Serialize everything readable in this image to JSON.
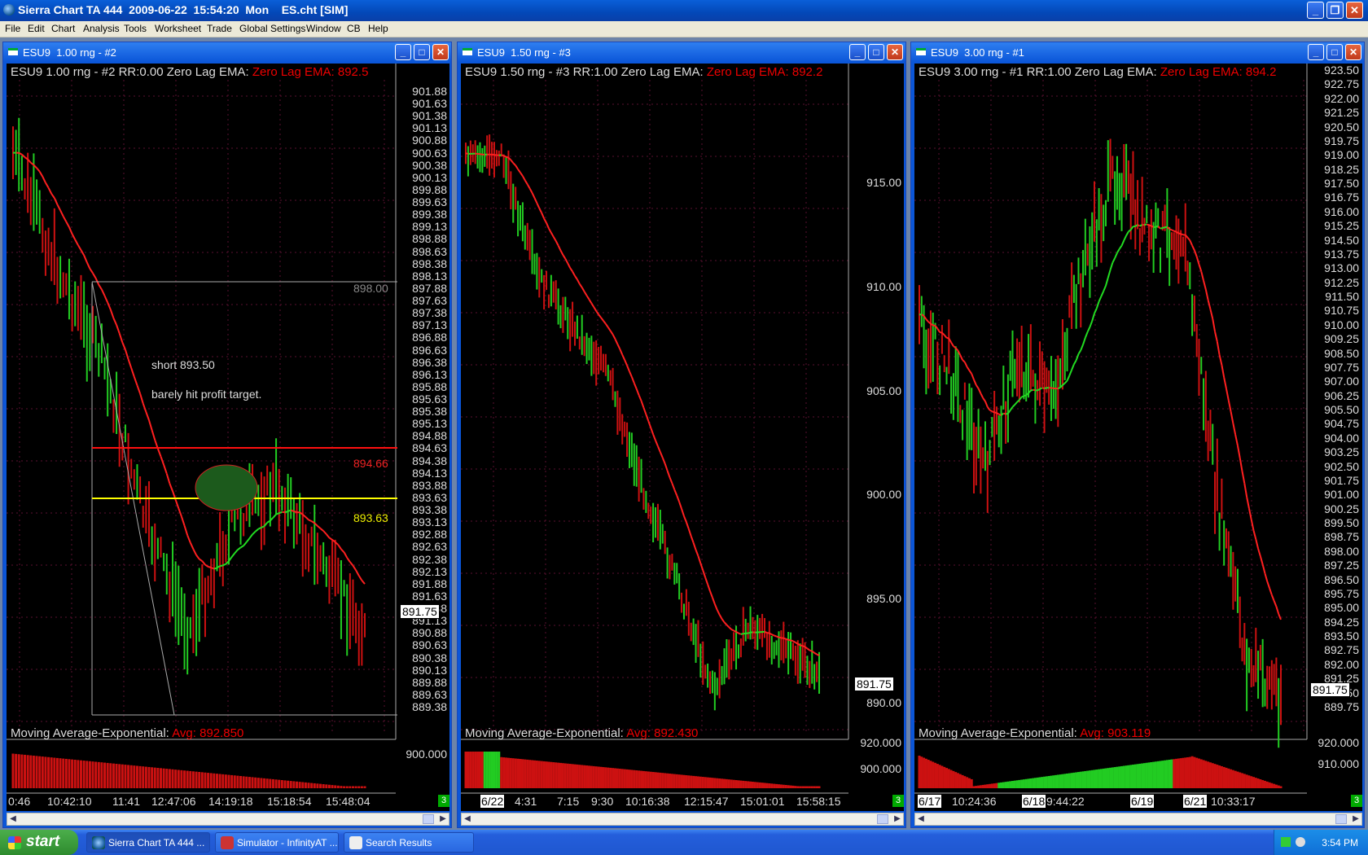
{
  "app": {
    "title": "Sierra Chart TA 444  2009-06-22  15:54:20  Mon    ES.cht [SIM]",
    "menu": [
      "File",
      "Edit",
      "Chart",
      "Analysis",
      "Tools",
      "Worksheet",
      "Trade",
      "Global Settings",
      "Window",
      "CB",
      "Help"
    ]
  },
  "windows": [
    {
      "title": "ESU9  1.00 rng - #2",
      "header": "ESU9  1.00 rng - #2  RR:0.00  Zero Lag EMA:",
      "header_value": "Zero Lag EMA: 892.5",
      "price_labels": [
        "901.88",
        "901.63",
        "901.38",
        "901.13",
        "900.88",
        "900.63",
        "900.38",
        "900.13",
        "899.88",
        "899.63",
        "899.38",
        "899.13",
        "898.88",
        "898.63",
        "898.38",
        "898.13",
        "897.88",
        "897.63",
        "897.38",
        "897.13",
        "896.88",
        "896.63",
        "896.38",
        "896.13",
        "895.88",
        "895.63",
        "895.38",
        "895.13",
        "894.88",
        "894.63",
        "894.38",
        "894.13",
        "893.88",
        "893.63",
        "893.38",
        "893.13",
        "892.88",
        "892.63",
        "892.38",
        "892.13",
        "891.88",
        "891.63",
        "891.38",
        "891.13",
        "890.88",
        "890.63",
        "890.38",
        "890.13",
        "889.88",
        "889.63",
        "889.38"
      ],
      "last_price": "891.75",
      "study_label": "Moving Average-Exponential:",
      "study_value": "Avg: 892.850",
      "study_axis": "900.000",
      "time_labels": [
        "0:46",
        "10:42:10",
        "11:41",
        "12:47:06",
        "14:19:18",
        "15:18:54",
        "15:48:04"
      ],
      "page": "3",
      "annotation_1": "short 893.50",
      "annotation_2": "barely hit profit target.",
      "level_top": "898.00",
      "level_red": "894.66",
      "level_yellow": "893.63"
    },
    {
      "title": "ESU9  1.50 rng - #3",
      "header": "ESU9  1.50 rng - #3  RR:1.00  Zero Lag EMA:",
      "header_value": "Zero Lag EMA: 892.2",
      "price_labels": [
        "915.00",
        "910.00",
        "905.00",
        "900.00",
        "895.00",
        "890.00"
      ],
      "last_price": "891.75",
      "study_label": "Moving Average-Exponential:",
      "study_value": "Avg: 892.430",
      "study_axis_1": "920.000",
      "study_axis_2": "900.000",
      "time_labels": [
        "6/22",
        "4:31",
        "7:15",
        "9:30",
        "10:16:38",
        "12:15:47",
        "15:01:01",
        "15:58:15"
      ],
      "page": "3"
    },
    {
      "title": "ESU9  3.00 rng - #1",
      "header": "ESU9  3.00 rng - #1  RR:1.00  Zero Lag EMA:",
      "header_value": "Zero Lag EMA: 894.2",
      "price_labels": [
        "923.50",
        "922.75",
        "922.00",
        "921.25",
        "920.50",
        "919.75",
        "919.00",
        "918.25",
        "917.50",
        "916.75",
        "916.00",
        "915.25",
        "914.50",
        "913.75",
        "913.00",
        "912.25",
        "911.50",
        "910.75",
        "910.00",
        "909.25",
        "908.50",
        "907.75",
        "907.00",
        "906.25",
        "905.50",
        "904.75",
        "904.00",
        "903.25",
        "902.50",
        "901.75",
        "901.00",
        "900.25",
        "899.50",
        "898.75",
        "898.00",
        "897.25",
        "896.50",
        "895.75",
        "895.00",
        "894.25",
        "893.50",
        "892.75",
        "892.00",
        "891.25",
        "890.50",
        "889.75"
      ],
      "last_price": "891.75",
      "study_label": "Moving Average-Exponential:",
      "study_value": "Avg: 903.119",
      "study_axis_1": "920.000",
      "study_axis_2": "910.000",
      "time_labels": [
        "6/17",
        "10:24:36",
        "6/18",
        "9:44:22",
        "6/19",
        "6/21",
        "10:33:17"
      ],
      "page": "3"
    }
  ],
  "taskbar": {
    "start": "start",
    "items": [
      "Sierra Chart TA 444 ...",
      "Simulator - InfinityAT ...",
      "Search Results"
    ],
    "clock": "3:54 PM"
  },
  "colors": {
    "up": "#22cc22",
    "down": "#cc1111",
    "ema": "#ff2020",
    "avg": "#22dd22"
  }
}
